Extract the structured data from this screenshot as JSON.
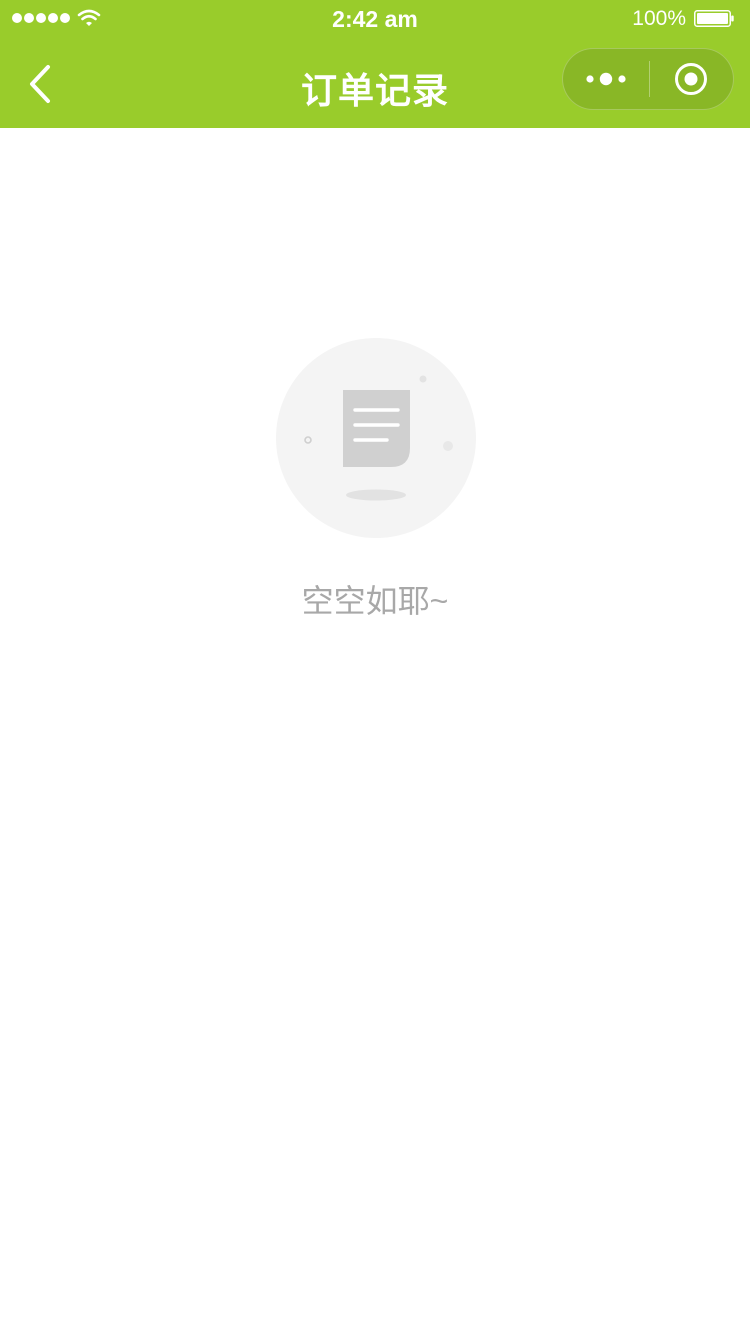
{
  "status_bar": {
    "time": "2:42 am",
    "battery_percent": "100%",
    "signal_bars": 5
  },
  "nav": {
    "title": "订单记录",
    "back_icon": "chevron-left-icon",
    "more_icon": "more-dots-icon",
    "close_icon": "target-close-icon"
  },
  "empty_state": {
    "message": "空空如耶~",
    "icon": "document-icon"
  },
  "colors": {
    "brand": "#99cc2b",
    "empty_text": "#a8a8a8",
    "illustration_bg": "#f4f4f4",
    "document": "#d0d0d0"
  }
}
